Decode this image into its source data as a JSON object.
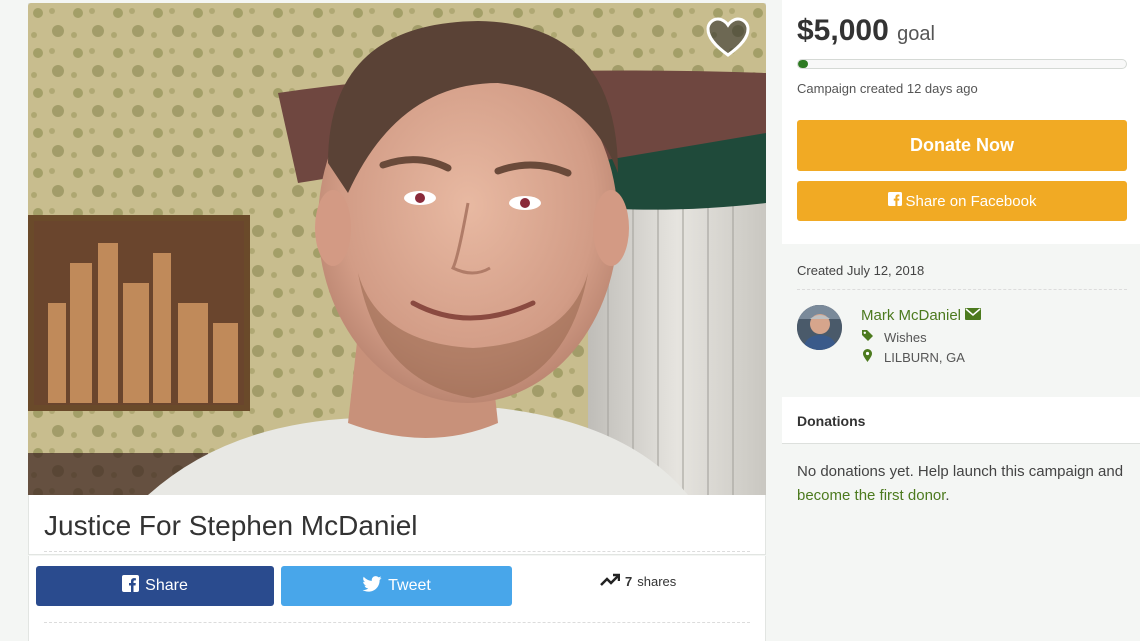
{
  "campaign": {
    "title": "Justice For Stephen McDaniel",
    "photo_icon": "campaign-photo"
  },
  "share": {
    "facebook_label": "Share",
    "twitter_label": "Tweet",
    "shares_count": "7",
    "shares_suffix": "shares"
  },
  "goal": {
    "amount": "$5,000",
    "label": "goal",
    "progress_fraction": 0.03,
    "created_ago": "Campaign created 12 days ago",
    "donate_label": "Donate Now",
    "share_facebook_label": "Share on Facebook"
  },
  "organizer": {
    "created_date": "Created July 12, 2018",
    "name": "Mark McDaniel",
    "category": "Wishes",
    "location": "LILBURN, GA"
  },
  "donations": {
    "title": "Donations",
    "empty_text": "No donations yet. Help launch this campaign and",
    "link_text": "become the first donor",
    "trailing": "."
  },
  "colors": {
    "accent": "#f1aa24",
    "brand_green": "#4c7a1e",
    "facebook": "#2a4b8e",
    "twitter": "#48a6ea"
  }
}
